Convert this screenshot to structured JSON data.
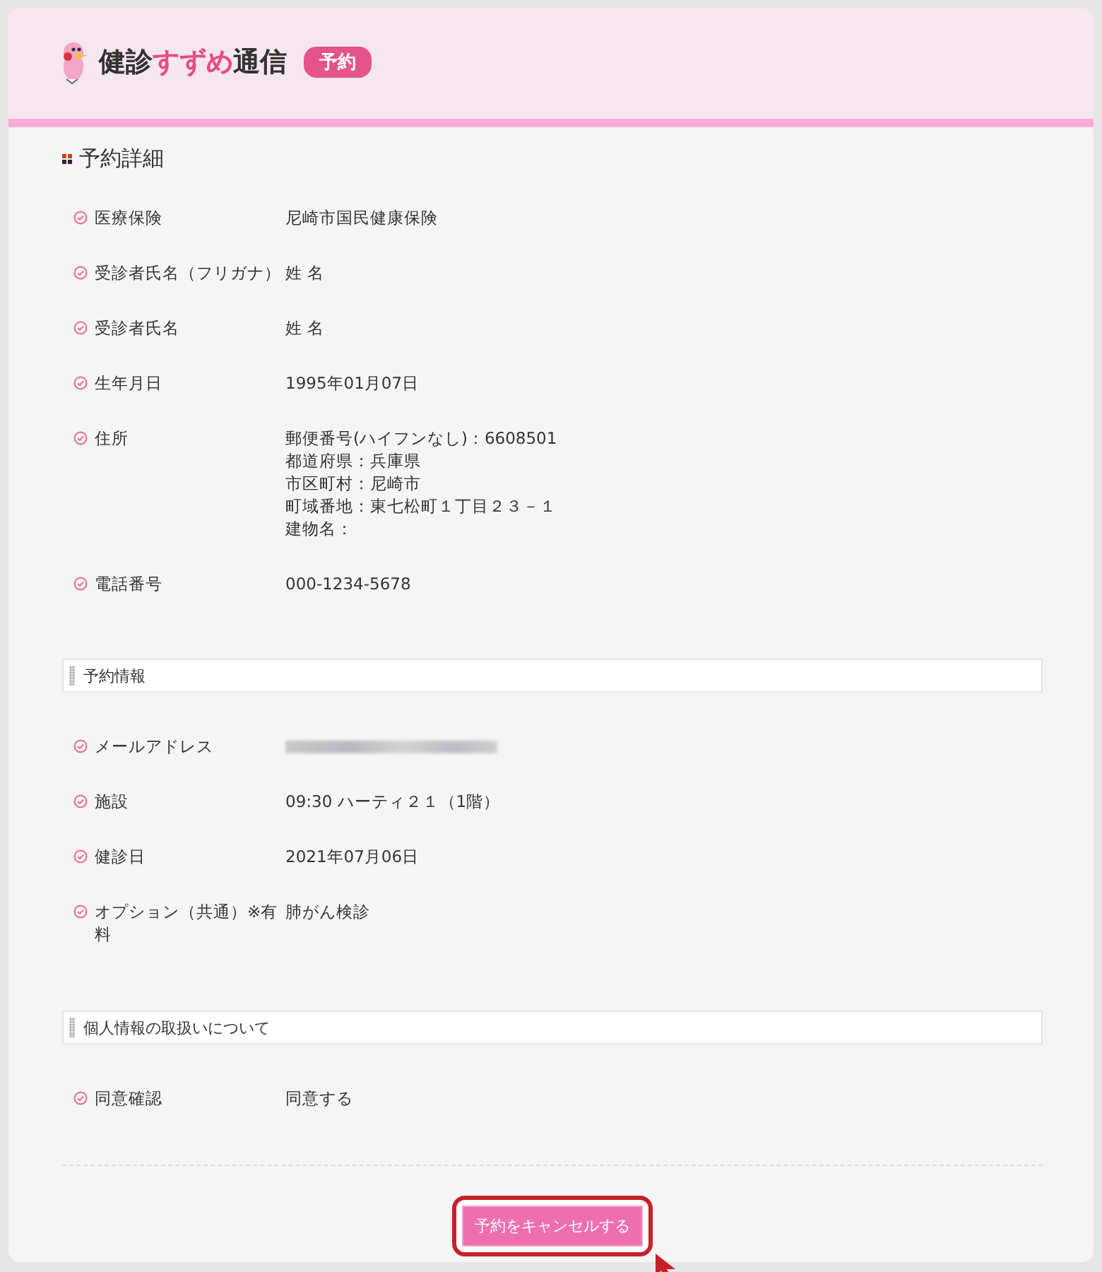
{
  "header": {
    "logo": [
      {
        "text": "健診",
        "kind": "plain"
      },
      {
        "text": "すずめ",
        "kind": "accent"
      },
      {
        "text": "通信",
        "kind": "plain"
      }
    ],
    "badge": "予約"
  },
  "title": "予約詳細",
  "sections": [
    {
      "rows": [
        {
          "label": "医療保険",
          "kind": "text",
          "value": [
            "尼崎市国民健康保険"
          ]
        },
        {
          "label": "受診者氏名（フリガナ）",
          "kind": "text",
          "value": [
            "姓 名"
          ]
        },
        {
          "label": "受診者氏名",
          "kind": "text",
          "value": [
            "姓 名"
          ]
        },
        {
          "label": "生年月日",
          "kind": "text",
          "value": [
            "1995年01月07日"
          ]
        },
        {
          "label": "住所",
          "kind": "text",
          "value": [
            "郵便番号(ハイフンなし)：6608501",
            "都道府県：兵庫県",
            "市区町村：尼崎市",
            "町域番地：東七松町１丁目２３－１",
            "建物名："
          ]
        },
        {
          "label": "電話番号",
          "kind": "text",
          "value": [
            "000-1234-5678"
          ]
        }
      ]
    },
    {
      "heading": "予約情報",
      "rows": [
        {
          "label": "メールアドレス",
          "kind": "redacted"
        },
        {
          "label": "施設",
          "kind": "text",
          "value": [
            "09:30 ハーティ２１（1階）"
          ]
        },
        {
          "label": "健診日",
          "kind": "text",
          "value": [
            "2021年07月06日"
          ]
        },
        {
          "label": "オプション（共通）※有料",
          "kind": "text",
          "value": [
            "肺がん検診"
          ]
        }
      ]
    },
    {
      "heading": "個人情報の取扱いについて",
      "rows": [
        {
          "label": "同意確認",
          "kind": "text",
          "value": [
            "同意する"
          ]
        }
      ]
    }
  ],
  "cancel_button": {
    "label": "予約をキャンセルする",
    "highlighted": true
  }
}
